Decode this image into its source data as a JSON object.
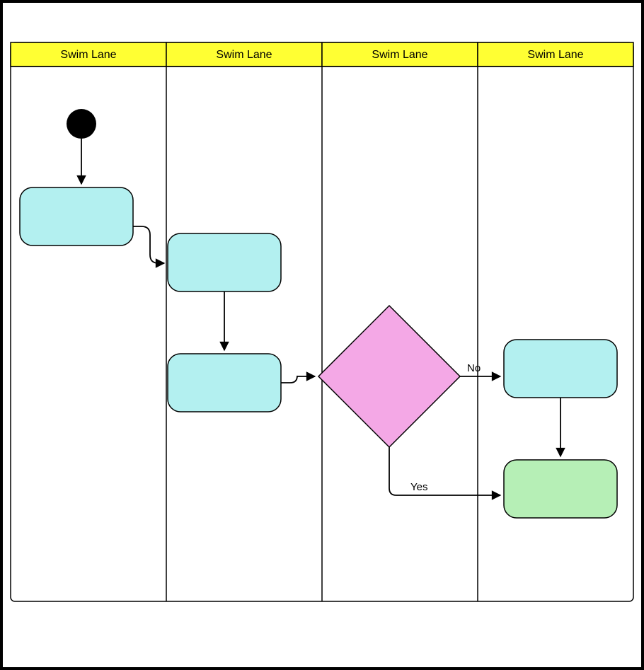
{
  "diagram": {
    "type": "swimlane-flowchart",
    "lanes": [
      {
        "label": "Swim Lane"
      },
      {
        "label": "Swim Lane"
      },
      {
        "label": "Swim Lane"
      },
      {
        "label": "Swim Lane"
      }
    ],
    "nodes": {
      "start": {
        "type": "start",
        "lane": 0
      },
      "task1": {
        "type": "task",
        "lane": 0,
        "label": ""
      },
      "task2": {
        "type": "task",
        "lane": 1,
        "label": ""
      },
      "task3": {
        "type": "task",
        "lane": 1,
        "label": ""
      },
      "decision": {
        "type": "decision",
        "lane": 2,
        "label": ""
      },
      "task4": {
        "type": "task",
        "lane": 3,
        "label": ""
      },
      "task5": {
        "type": "end-task",
        "lane": 3,
        "label": ""
      }
    },
    "edges": [
      {
        "from": "start",
        "to": "task1",
        "label": ""
      },
      {
        "from": "task1",
        "to": "task2",
        "label": ""
      },
      {
        "from": "task2",
        "to": "task3",
        "label": ""
      },
      {
        "from": "task3",
        "to": "decision",
        "label": ""
      },
      {
        "from": "decision",
        "to": "task4",
        "label": "No"
      },
      {
        "from": "decision",
        "to": "task5",
        "label": "Yes"
      },
      {
        "from": "task4",
        "to": "task5",
        "label": ""
      }
    ]
  }
}
